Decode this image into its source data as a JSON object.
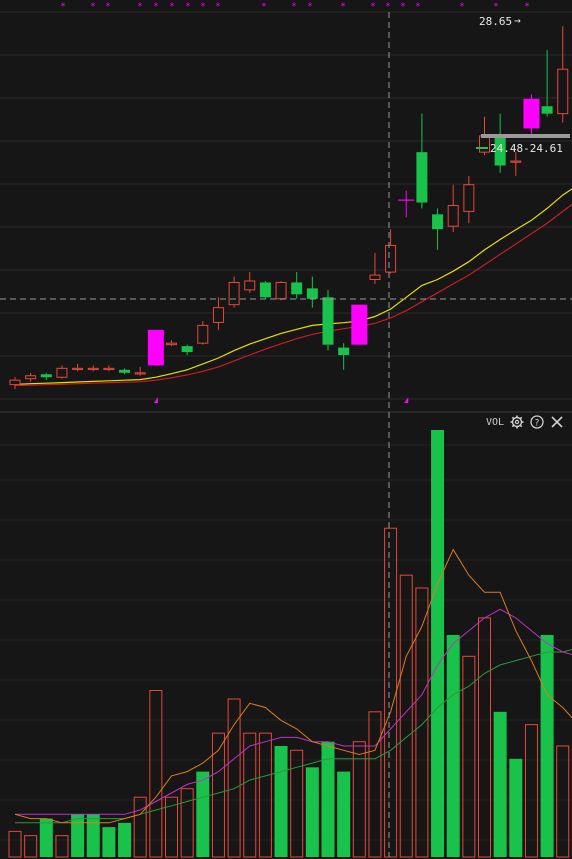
{
  "colors": {
    "background": "#161616",
    "grid": "#2a2a2a",
    "up": "#e5483a",
    "down": "#19c24a",
    "highlight": "#ff00ff",
    "ma_short": "#e8e000",
    "ma_long": "#c81e1e",
    "vol_ma1": "#e07b1a",
    "vol_ma2": "#c030c8",
    "vol_ma3": "#2a9a3a",
    "crosshair": "#9a9a9a"
  },
  "price_labels": {
    "high": "28.65",
    "range": "24.48-24.61"
  },
  "vol_panel": {
    "label": "VOL",
    "settings_icon": "gear-icon",
    "help_icon": "question-icon",
    "close_icon": "close-icon"
  },
  "chart_data": [
    {
      "type": "candlestick",
      "price_axis": {
        "min": 16.2,
        "max": 29.2
      },
      "candles": [
        {
          "o": 16.55,
          "c": 16.7,
          "h": 16.8,
          "l": 16.4,
          "hl": false
        },
        {
          "o": 16.75,
          "c": 16.85,
          "h": 16.95,
          "l": 16.65,
          "hl": false
        },
        {
          "o": 16.9,
          "c": 16.8,
          "h": 16.95,
          "l": 16.7,
          "hl": false
        },
        {
          "o": 16.8,
          "c": 17.1,
          "h": 17.2,
          "l": 16.75,
          "hl": false
        },
        {
          "o": 17.1,
          "c": 17.1,
          "h": 17.25,
          "l": 17.0,
          "hl": false
        },
        {
          "o": 17.1,
          "c": 17.1,
          "h": 17.2,
          "l": 17.0,
          "hl": false
        },
        {
          "o": 17.1,
          "c": 17.1,
          "h": 17.2,
          "l": 17.0,
          "hl": false
        },
        {
          "o": 17.05,
          "c": 16.95,
          "h": 17.1,
          "l": 16.9,
          "hl": false
        },
        {
          "o": 16.95,
          "c": 16.95,
          "h": 17.15,
          "l": 16.85,
          "hl": false
        },
        {
          "o": 18.4,
          "c": 17.2,
          "h": 18.4,
          "l": 17.2,
          "hl": true
        },
        {
          "o": 17.9,
          "c": 17.95,
          "h": 18.05,
          "l": 17.85,
          "hl": false
        },
        {
          "o": 17.85,
          "c": 17.65,
          "h": 17.9,
          "l": 17.55,
          "hl": false
        },
        {
          "o": 17.95,
          "c": 18.55,
          "h": 18.7,
          "l": 17.9,
          "hl": false
        },
        {
          "o": 18.65,
          "c": 19.15,
          "h": 19.5,
          "l": 18.4,
          "hl": false
        },
        {
          "o": 19.25,
          "c": 20.0,
          "h": 20.2,
          "l": 19.15,
          "hl": false
        },
        {
          "o": 19.75,
          "c": 20.05,
          "h": 20.35,
          "l": 19.65,
          "hl": false
        },
        {
          "o": 20.0,
          "c": 19.5,
          "h": 20.05,
          "l": 19.45,
          "hl": false
        },
        {
          "o": 19.45,
          "c": 20.0,
          "h": 20.05,
          "l": 19.4,
          "hl": false
        },
        {
          "o": 20.0,
          "c": 19.6,
          "h": 20.35,
          "l": 19.45,
          "hl": false
        },
        {
          "o": 19.8,
          "c": 19.45,
          "h": 20.2,
          "l": 19.15,
          "hl": false
        },
        {
          "o": 19.5,
          "c": 17.9,
          "h": 19.75,
          "l": 17.7,
          "hl": false
        },
        {
          "o": 17.8,
          "c": 17.55,
          "h": 17.95,
          "l": 17.05,
          "hl": false
        },
        {
          "o": 19.25,
          "c": 17.9,
          "h": 19.25,
          "l": 17.9,
          "hl": true
        },
        {
          "o": 20.1,
          "c": 20.25,
          "h": 21.0,
          "l": 19.95,
          "hl": false
        },
        {
          "o": 20.35,
          "c": 21.25,
          "h": 21.8,
          "l": 20.3,
          "hl": false
        },
        {
          "o": 22.8,
          "c": 22.8,
          "h": 23.1,
          "l": 22.2,
          "hl": true
        },
        {
          "o": 24.4,
          "c": 22.7,
          "h": 25.7,
          "l": 22.5,
          "hl": false
        },
        {
          "o": 22.3,
          "c": 21.8,
          "h": 22.5,
          "l": 21.1,
          "hl": false
        },
        {
          "o": 21.9,
          "c": 22.6,
          "h": 23.3,
          "l": 21.7,
          "hl": false
        },
        {
          "o": 22.4,
          "c": 23.3,
          "h": 23.6,
          "l": 22.0,
          "hl": false
        },
        {
          "o": 24.4,
          "c": 24.95,
          "h": 25.6,
          "l": 24.3,
          "hl": false
        },
        {
          "o": 25.0,
          "c": 23.95,
          "h": 25.7,
          "l": 23.7,
          "hl": false
        },
        {
          "o": 24.1,
          "c": 24.1,
          "h": 24.4,
          "l": 23.6,
          "hl": false
        },
        {
          "o": 26.2,
          "c": 25.2,
          "h": 26.35,
          "l": 24.9,
          "hl": true
        },
        {
          "o": 25.95,
          "c": 25.7,
          "h": 27.85,
          "l": 25.6,
          "hl": false
        },
        {
          "o": 25.7,
          "c": 27.2,
          "h": 28.65,
          "l": 25.4,
          "hl": false
        },
        {
          "o": 27.8,
          "c": 27.95,
          "h": 28.5,
          "l": 26.7,
          "hl": false
        }
      ],
      "ma_short": [
        16.56,
        16.58,
        16.6,
        16.62,
        16.64,
        16.66,
        16.68,
        16.7,
        16.72,
        16.8,
        16.92,
        17.05,
        17.25,
        17.45,
        17.7,
        17.92,
        18.1,
        18.28,
        18.42,
        18.55,
        18.6,
        18.64,
        18.7,
        18.85,
        19.1,
        19.5,
        19.9,
        20.1,
        20.38,
        20.7,
        21.1,
        21.45,
        21.78,
        22.1,
        22.5,
        22.95,
        23.3
      ],
      "ma_long": [
        16.52,
        16.53,
        16.55,
        16.56,
        16.58,
        16.6,
        16.62,
        16.63,
        16.65,
        16.7,
        16.78,
        16.88,
        17.0,
        17.15,
        17.35,
        17.55,
        17.75,
        17.93,
        18.1,
        18.25,
        18.35,
        18.44,
        18.52,
        18.62,
        18.8,
        19.05,
        19.35,
        19.65,
        19.95,
        20.25,
        20.6,
        20.95,
        21.3,
        21.65,
        22.0,
        22.4,
        22.8
      ],
      "marker_top_count": 14,
      "marker_bottom": [
        9,
        25
      ]
    },
    {
      "type": "bar",
      "title": "VOL",
      "volume_axis": {
        "min": 0,
        "max": 100
      },
      "values": [
        6,
        5,
        9,
        5,
        10,
        10,
        7,
        8,
        14,
        39,
        14,
        16,
        20,
        29,
        37,
        29,
        29,
        26,
        25,
        21,
        27,
        20,
        27,
        34,
        77,
        66,
        63,
        100,
        52,
        47,
        56,
        34,
        23,
        31,
        52,
        26,
        26
      ],
      "up": [
        true,
        true,
        false,
        true,
        false,
        false,
        false,
        false,
        true,
        true,
        true,
        true,
        false,
        true,
        true,
        true,
        true,
        false,
        true,
        false,
        false,
        false,
        true,
        true,
        true,
        true,
        true,
        false,
        false,
        true,
        true,
        false,
        false,
        true,
        false,
        true,
        true
      ],
      "ma1": [
        10,
        9,
        9,
        8,
        8,
        8,
        8,
        9,
        10,
        14,
        19,
        20,
        22,
        25,
        31,
        36,
        35,
        32,
        30,
        27,
        26,
        25,
        24,
        25,
        34,
        47,
        54,
        64,
        72,
        66,
        62,
        62,
        53,
        46,
        38,
        35,
        31
      ],
      "ma2": [
        10,
        10,
        10,
        10,
        10,
        10,
        10,
        10,
        11,
        13,
        15,
        17,
        18,
        20,
        23,
        26,
        27,
        28,
        28,
        27,
        27,
        26,
        26,
        26,
        30,
        34,
        38,
        45,
        50,
        53,
        56,
        58,
        56,
        53,
        50,
        48,
        47
      ],
      "ma3": [
        8,
        8,
        8,
        8,
        9,
        9,
        9,
        9,
        10,
        11,
        12,
        13,
        14,
        15,
        16,
        18,
        19,
        20,
        21,
        22,
        23,
        23,
        23,
        23,
        25,
        28,
        31,
        35,
        38,
        40,
        43,
        45,
        46,
        47,
        48,
        48,
        49
      ]
    }
  ]
}
